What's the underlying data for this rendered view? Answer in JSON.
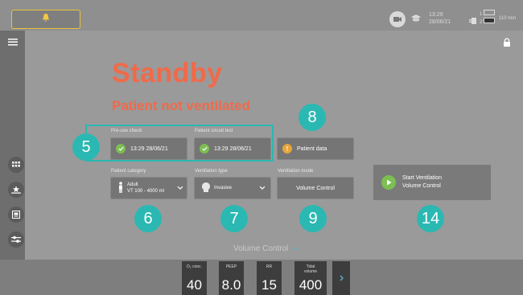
{
  "header": {
    "time": "13:29",
    "date": "28/06/21",
    "battery_text": "110 min",
    "battery_top": "1",
    "battery_bottom": "2"
  },
  "status": {
    "title": "Standby",
    "subtitle": "Patient not ventilated"
  },
  "checks": {
    "preuse_label": "Pre-use check",
    "preuse_value": "13:29 28/06/21",
    "circuit_label": "Patient circuit test",
    "circuit_value": "13:29 28/06/21",
    "patient_data_label": "Patient data"
  },
  "settings": {
    "category_label": "Patient category",
    "category_line1": "Adult",
    "category_line2": "VT 100 - 4000 ml",
    "vent_type_label": "Ventilation type",
    "vent_type_value": "Invasive",
    "vent_mode_label": "Ventilation mode",
    "vent_mode_value": "Volume Control"
  },
  "start": {
    "line1": "Start Ventilation",
    "line2": "Volume Control"
  },
  "callouts": {
    "c5": "5",
    "c6": "6",
    "c7": "7",
    "c8": "8",
    "c9": "9",
    "c14": "14"
  },
  "mode_selector": "Volume Control",
  "params": [
    {
      "label": "O₂ conc.",
      "value": "40"
    },
    {
      "label": "PEEP",
      "value": "8.0"
    },
    {
      "label": "RR",
      "value": "15"
    },
    {
      "label": "Tidal volume",
      "value": "400"
    }
  ],
  "colors": {
    "accent": "#2bb8b2",
    "alert": "#f06a4a",
    "ok": "#7cbf52",
    "warning": "#e8a53a"
  }
}
